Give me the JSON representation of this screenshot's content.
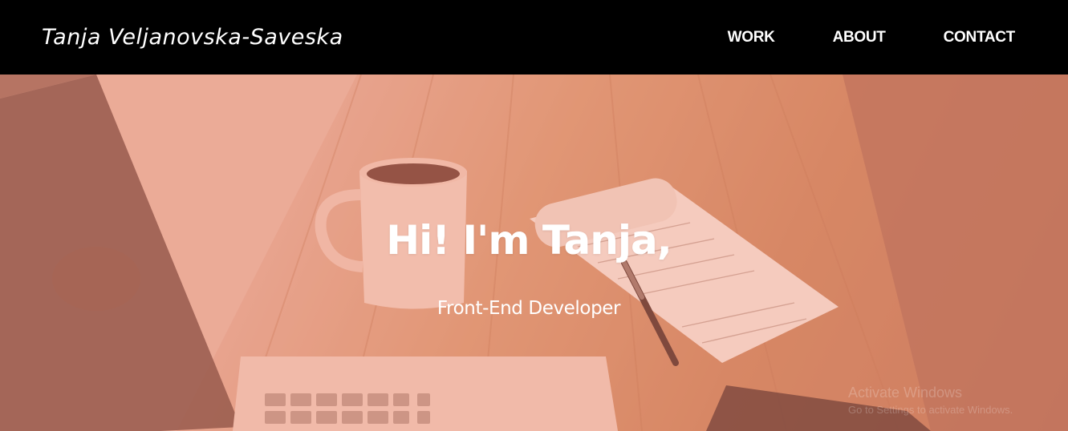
{
  "header": {
    "brand": "Tanja Veljanovska-Saveska",
    "nav": [
      {
        "label": "WORK"
      },
      {
        "label": "ABOUT"
      },
      {
        "label": "CONTACT"
      }
    ]
  },
  "hero": {
    "title": "Hi! I'm Tanja,",
    "subtitle": "Front-End Developer",
    "background_image": "desk-with-coffee-mug-notepad-pen-laptop",
    "tint_color": "#e9967f"
  },
  "watermark": {
    "title": "Activate Windows",
    "subtitle": "Go to Settings to activate Windows."
  },
  "colors": {
    "navbar_bg": "#000000",
    "nav_text": "#ffffff",
    "hero_text": "#ffffff"
  }
}
